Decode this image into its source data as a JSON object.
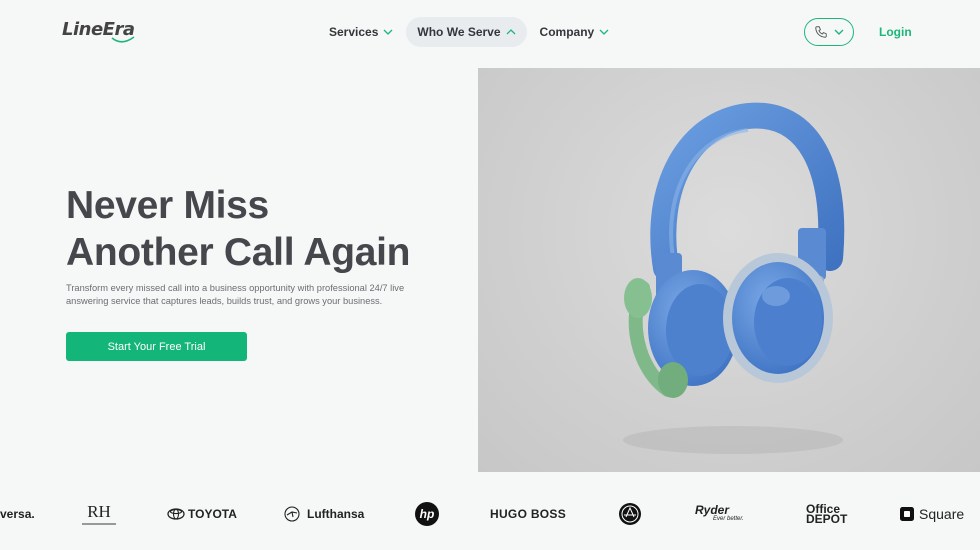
{
  "header": {
    "logo_text": "LineEra",
    "nav": [
      {
        "label": "Services"
      },
      {
        "label": "Who We Serve"
      },
      {
        "label": "Company"
      }
    ],
    "login_label": "Login"
  },
  "hero": {
    "title_line1": "Never Miss",
    "title_line2": "Another Call Again",
    "description": "Transform every missed call into a business opportunity with professional 24/7 live answering service that captures leads, builds trust, and grows your business.",
    "cta_label": "Start Your Free Trial"
  },
  "logos": {
    "universa": "versa.",
    "rh": "RH",
    "toyota": "TOYOTA",
    "lufthansa": "Lufthansa",
    "hp": "hp",
    "hugo_boss": "HUGO BOSS",
    "ryder": "Ryder",
    "ryder_tag": "Ever better.",
    "office_depot_1": "Office",
    "office_depot_2": "DEPOT",
    "square": "Square"
  },
  "colors": {
    "accent": "#14b579",
    "background": "#f6f8f7",
    "headphone_blue": "#5b8fd6",
    "mic_green": "#7fb98a"
  }
}
